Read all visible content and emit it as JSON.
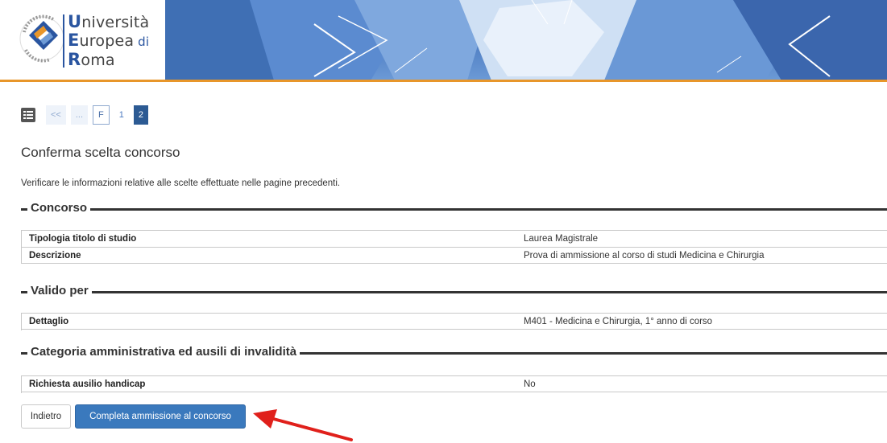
{
  "header": {
    "logo_lines": [
      {
        "initial": "U",
        "rest": "niversità",
        "suffix": ""
      },
      {
        "initial": "E",
        "rest": "uropea",
        "suffix": " di"
      },
      {
        "initial": "R",
        "rest": "oma",
        "suffix": ""
      }
    ],
    "seal_motto": "VINCE IN BONO MALUM",
    "accent_color": "#e8962a",
    "brand_color": "#2a55a0"
  },
  "nav": {
    "icon": "list-icon",
    "pages": [
      {
        "label": "<<",
        "state": "faded"
      },
      {
        "label": "...",
        "state": "faded"
      },
      {
        "label": "F",
        "state": "outlined"
      },
      {
        "label": "1",
        "state": "normal"
      },
      {
        "label": "2",
        "state": "active"
      }
    ]
  },
  "page": {
    "title": "Conferma scelta concorso",
    "intro": "Verificare le informazioni relative alle scelte effettuate nelle pagine precedenti."
  },
  "sections": {
    "concorso": {
      "legend": "Concorso",
      "rows": [
        {
          "label": "Tipologia titolo di studio",
          "value": "Laurea Magistrale"
        },
        {
          "label": "Descrizione",
          "value": "Prova di ammissione al corso di studi Medicina e Chirurgia"
        }
      ]
    },
    "valido": {
      "legend": "Valido per",
      "rows": [
        {
          "label": "Dettaglio",
          "value": "M401 - Medicina e Chirurgia, 1° anno di corso"
        }
      ]
    },
    "categoria": {
      "legend": "Categoria amministrativa ed ausili di invalidità",
      "rows": [
        {
          "label": "Richiesta ausilio handicap",
          "value": "No"
        }
      ]
    }
  },
  "actions": {
    "back_label": "Indietro",
    "complete_label": "Completa ammissione al concorso",
    "arrow_color": "#e0201b"
  }
}
